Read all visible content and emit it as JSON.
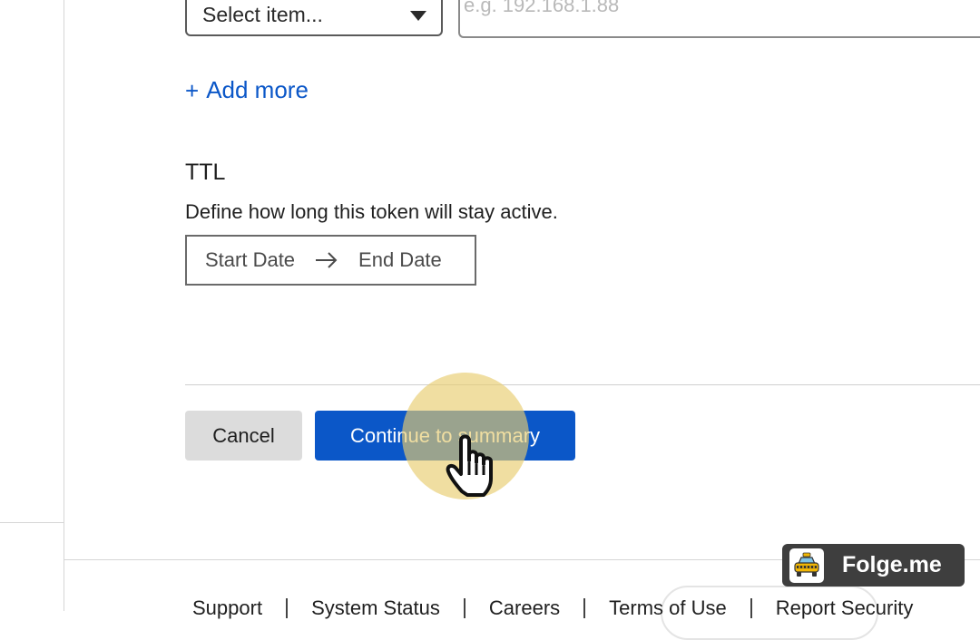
{
  "form": {
    "select_placeholder": "Select item...",
    "ip_placeholder": "e.g. 192.168.1.88",
    "add_more_label": "Add more",
    "ttl_heading": "TTL",
    "ttl_description": "Define how long this token will stay active.",
    "date_range": {
      "start_placeholder": "Start Date",
      "end_placeholder": "End Date"
    },
    "cancel_label": "Cancel",
    "continue_label": "Continue to summary"
  },
  "footer": {
    "links": [
      "Support",
      "System Status",
      "Careers",
      "Terms of Use",
      "Report Security"
    ]
  },
  "watermark": {
    "text": "Folge.me"
  },
  "colors": {
    "primary": "#0b57c8",
    "link": "#0b57c8",
    "cancel_bg": "#dcdcdc",
    "click_highlight": "#e8cd6e",
    "watermark_bg": "#3e3e3e"
  },
  "icons": [
    "chevron-down-icon",
    "plus-icon",
    "arrow-right-icon",
    "hand-cursor-icon",
    "taxi-logo-icon"
  ]
}
